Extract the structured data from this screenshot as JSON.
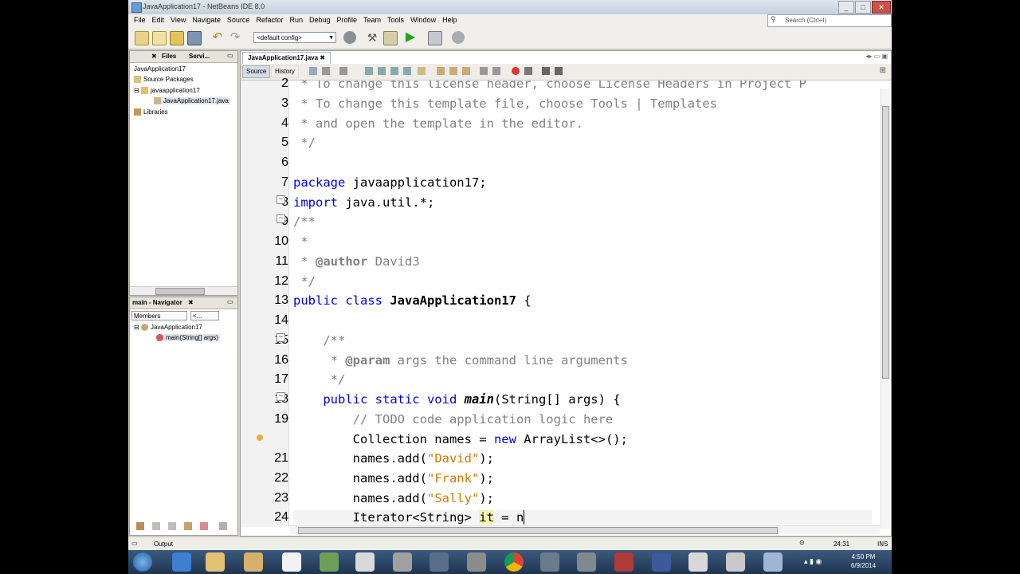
{
  "window": {
    "title": "JavaApplication17 - NetBeans IDE 8.0"
  },
  "menu": [
    "File",
    "Edit",
    "View",
    "Navigate",
    "Source",
    "Refactor",
    "Run",
    "Debug",
    "Profile",
    "Team",
    "Tools",
    "Window",
    "Help"
  ],
  "search": {
    "placeholder": "Search (Ctrl+I)"
  },
  "toolbar": {
    "config": "<default config>"
  },
  "projects": {
    "tabs": [
      "Files",
      "Servi..."
    ],
    "tree": [
      "JavaApplication17",
      "Source Packages",
      "javaapplication17",
      "JavaApplication17.java",
      "Libraries"
    ]
  },
  "navigator": {
    "title": "main - Navigator",
    "filter": "Members",
    "filter2": "<...",
    "tree": [
      "JavaApplication17",
      "main(String[] args)"
    ]
  },
  "editor": {
    "tab": "JavaApplication17.java",
    "source_tab": "Source",
    "history_tab": "History",
    "line_numbers": [
      "2",
      "3",
      "4",
      "5",
      "6",
      "7",
      "8",
      "9",
      "10",
      "11",
      "12",
      "13",
      "14",
      "15",
      "16",
      "17",
      "18",
      "19",
      "",
      "21",
      "22",
      "23",
      "24"
    ]
  },
  "status": {
    "output": "Output",
    "position": "24:31",
    "mode": "INS"
  },
  "taskbar": {
    "time": "4:50 PM",
    "date": "6/9/2014"
  }
}
